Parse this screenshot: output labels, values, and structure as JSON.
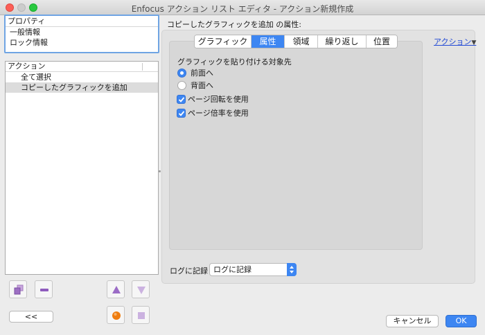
{
  "window": {
    "title": "Enfocus アクション リスト エディタ - アクション新規作成"
  },
  "properties_panel": {
    "header": "プロパティ",
    "items": [
      "一般情報",
      "ロック情報"
    ]
  },
  "actions_panel": {
    "header": "アクション",
    "items": [
      "全て選択",
      "コピーしたグラフィックを追加"
    ],
    "selected_index": 1
  },
  "left_buttons": {
    "back_label": "<<"
  },
  "attributes": {
    "title": "コピーしたグラフィックを追加 の属性:",
    "action_link": "アクション",
    "tabs": [
      "グラフィック",
      "属性",
      "領域",
      "繰り返し",
      "位置"
    ],
    "active_tab_index": 1,
    "paste_group_label": "グラフィックを貼り付ける対象先",
    "radio_options": [
      {
        "label": "前面へ",
        "selected": true
      },
      {
        "label": "背面へ",
        "selected": false
      }
    ],
    "checkboxes": [
      {
        "label": "ページ回転を使用",
        "checked": true
      },
      {
        "label": "ページ倍率を使用",
        "checked": true
      }
    ]
  },
  "log": {
    "label": "ログに記録",
    "selected_value": "ログに記録"
  },
  "footer": {
    "cancel_label": "キャンセル",
    "ok_label": "OK"
  },
  "colors": {
    "accent": "#3d86f2",
    "link": "#2149d5",
    "selection_row": "#dcdcdc",
    "focus_ring": "#6fa4e3"
  }
}
